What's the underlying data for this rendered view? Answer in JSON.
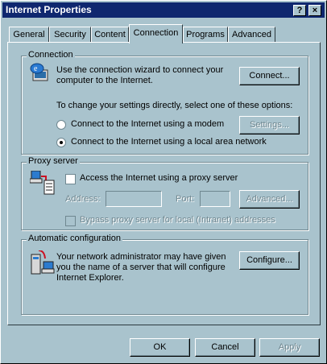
{
  "window": {
    "title": "Internet Properties",
    "help": "?",
    "close": "×"
  },
  "tabs": [
    {
      "label": "General"
    },
    {
      "label": "Security"
    },
    {
      "label": "Content"
    },
    {
      "label": "Connection"
    },
    {
      "label": "Programs"
    },
    {
      "label": "Advanced"
    }
  ],
  "connection": {
    "group_title": "Connection",
    "wizard_text": "Use the connection wizard to connect your computer to the Internet.",
    "connect_button": "Connect...",
    "change_text": "To change your settings directly, select one of these options:",
    "modem_option": "Connect to the Internet using a modem",
    "lan_option": "Connect to the Internet using a local area network",
    "settings_button": "Settings...",
    "selected": "lan"
  },
  "proxy": {
    "group_title": "Proxy server",
    "access_label": "Access the Internet using a proxy server",
    "address_label": "Address:",
    "address_value": "",
    "port_label": "Port:",
    "port_value": "",
    "advanced_button": "Advanced...",
    "bypass_label": "Bypass proxy server for local (Intranet) addresses"
  },
  "auto": {
    "group_title": "Automatic configuration",
    "description": "Your network administrator may have given you the name of a server that will configure Internet Explorer.",
    "configure_button": "Configure..."
  },
  "footer": {
    "ok": "OK",
    "cancel": "Cancel",
    "apply": "Apply"
  }
}
